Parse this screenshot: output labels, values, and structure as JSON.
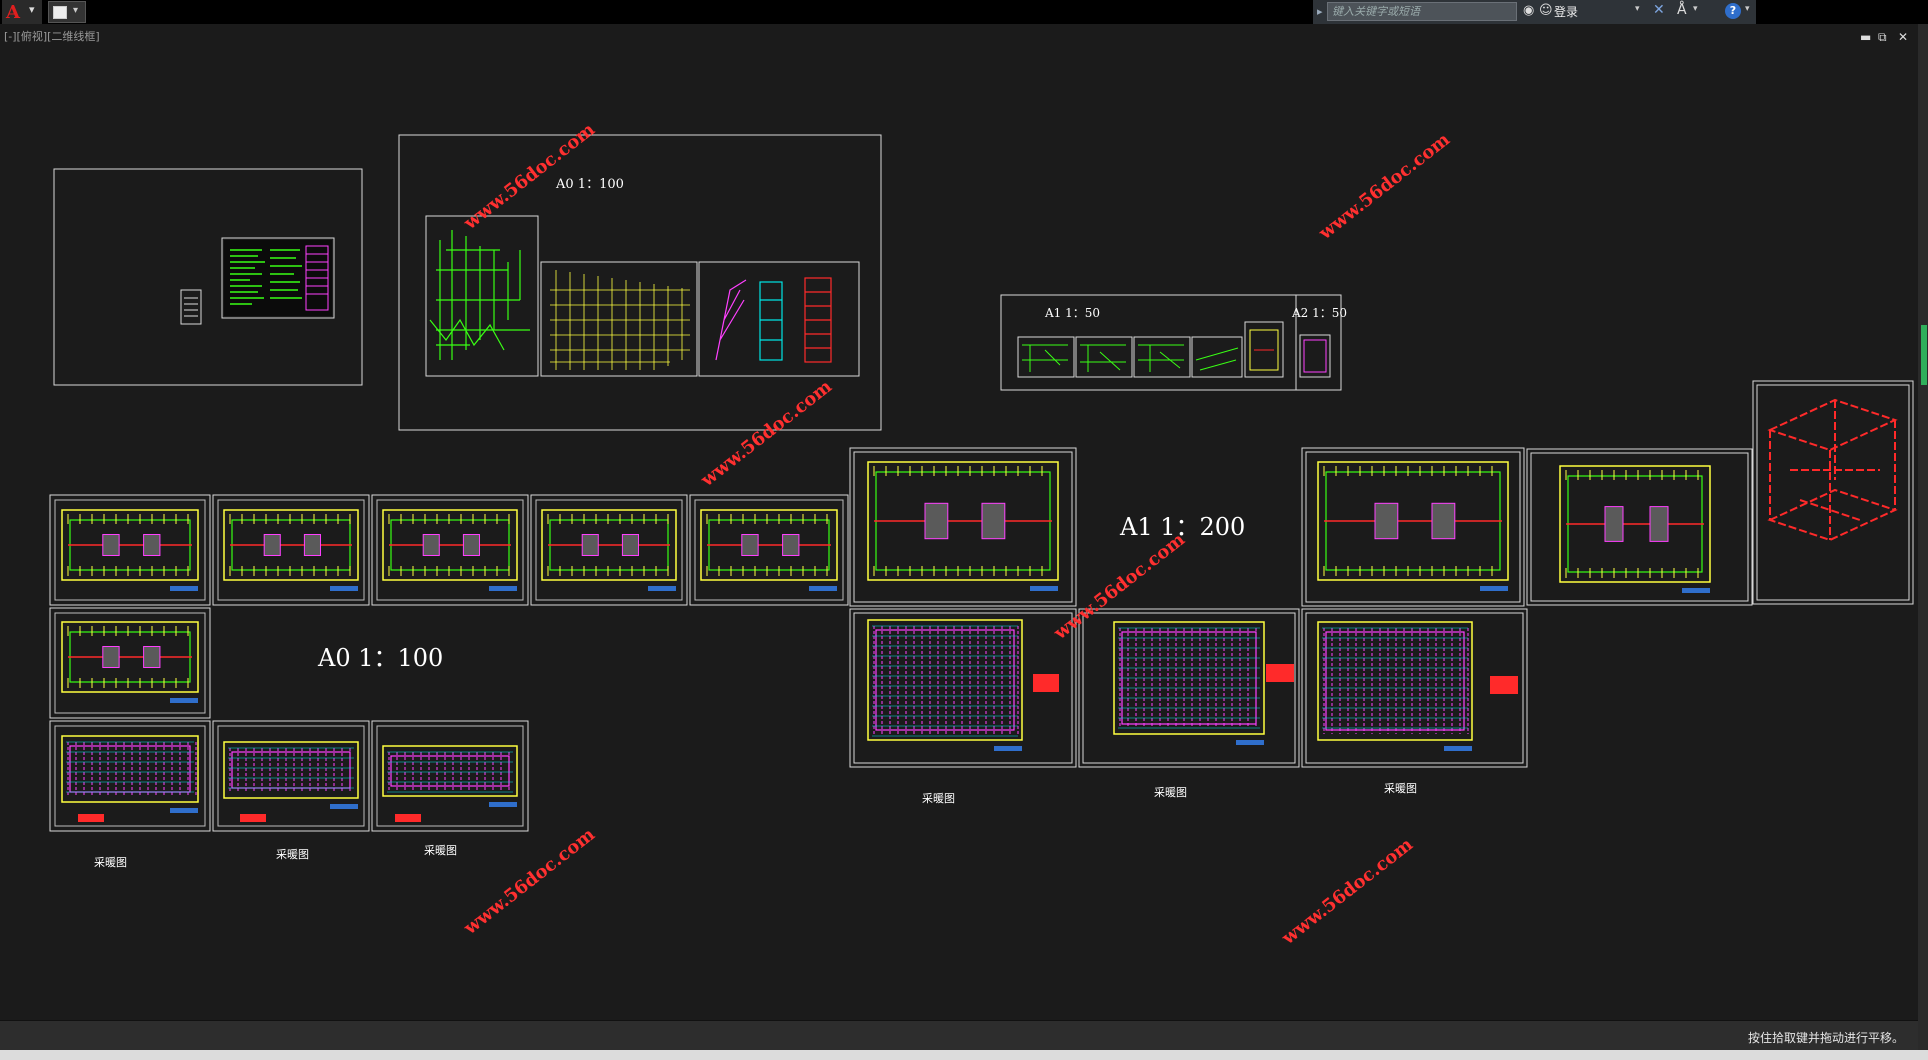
{
  "app": {
    "logo_glyph": "A",
    "menu_arrow": "▾"
  },
  "infocenter": {
    "search_placeholder": "键入关键字或短语",
    "login_label": "登录",
    "help_glyph": "?",
    "expand_glyph": "▸"
  },
  "viewport": {
    "label": "[-][俯视][二维线框]"
  },
  "window_controls": {
    "minimize": "▬",
    "restore": "⧉",
    "close": "✕"
  },
  "drawing": {
    "scale_labels": {
      "a0_top": "A0  1：100",
      "a1_50": "A1  1：50",
      "a2_50": "A2  1：50",
      "a1_200": "A1  1：200",
      "a0_left": "A0  1：100"
    },
    "watermark": "www.56doc.com",
    "captions": {
      "c1": "采暖图",
      "c2": "采暖图",
      "c3": "采暖图",
      "c4": "采暖图",
      "c5": "采暖图",
      "c6": "采暖图"
    }
  },
  "status": {
    "message": "按住拾取键并拖动进行平移。"
  },
  "colors": {
    "background": "#1b1b1b",
    "frame": "#d8d8d8",
    "accent_green": "#39ff14",
    "pipe_red": "#ff2a2a",
    "magenta": "#ff40ff",
    "cyan": "#00e5e5",
    "yellow": "#ffff40"
  }
}
